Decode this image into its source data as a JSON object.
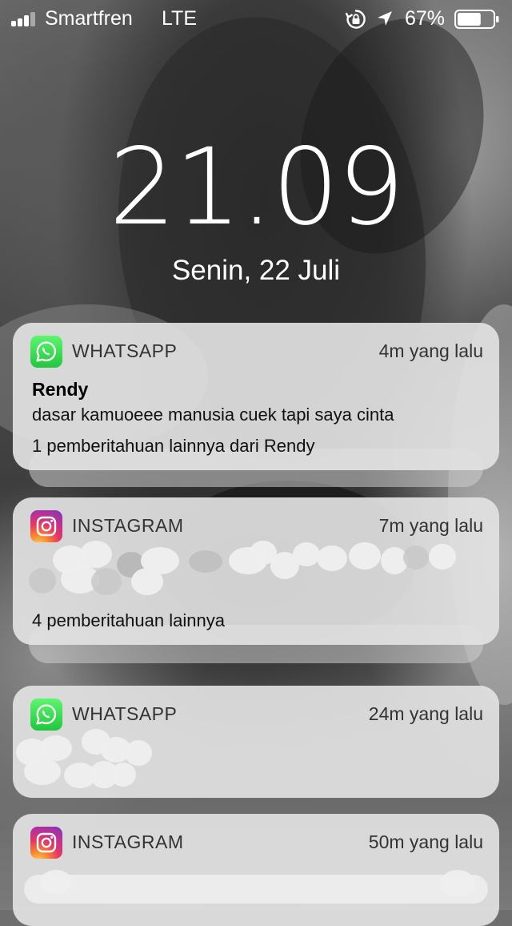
{
  "status_bar": {
    "carrier": "Smartfren",
    "network": "LTE",
    "battery_percent": "67%",
    "battery_level": 0.67,
    "icons": [
      "signal-icon",
      "rotation-lock-icon",
      "location-icon",
      "battery-icon"
    ]
  },
  "lock_screen": {
    "time": "21.09",
    "date": "Senin, 22 Juli"
  },
  "notifications": [
    {
      "app": "WHATSAPP",
      "icon": "whatsapp-icon",
      "time": "4m yang lalu",
      "title": "Rendy",
      "body": "dasar kamuoeee manusia cuek tapi saya cinta",
      "more": "1 pemberitahuan lainnya dari Rendy"
    },
    {
      "app": "INSTAGRAM",
      "icon": "instagram-icon",
      "time": "7m yang lalu",
      "more": "4 pemberitahuan lainnya"
    },
    {
      "app": "WHATSAPP",
      "icon": "whatsapp-icon",
      "time": "24m yang lalu"
    },
    {
      "app": "INSTAGRAM",
      "icon": "instagram-icon",
      "time": "50m yang lalu"
    }
  ],
  "colors": {
    "whatsapp_green": "#25D366",
    "notification_bg": "#E2E2E2",
    "text_dark": "#111111"
  }
}
